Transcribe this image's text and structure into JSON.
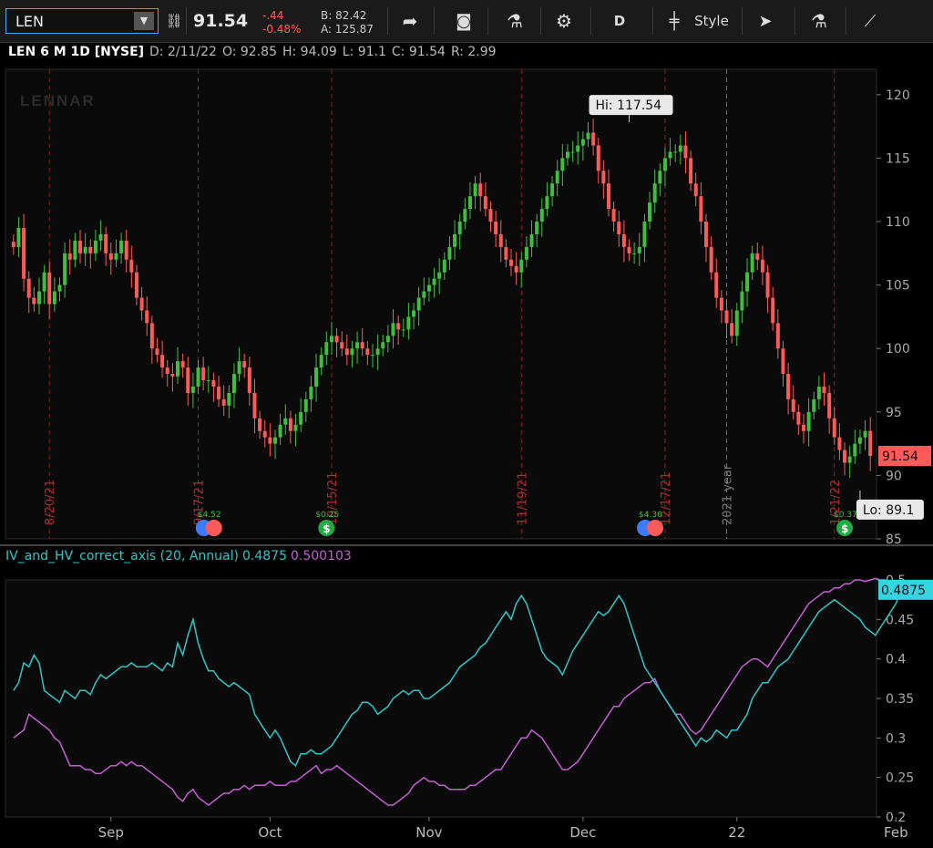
{
  "toolbar": {
    "symbol": "LEN",
    "last": "91.54",
    "change": "-.44",
    "change_pct": "-0.48%",
    "bid": "B: 82.42",
    "ask": "A: 125.87",
    "aggregation": "D",
    "style_label": "Style",
    "icons": [
      "link-icon",
      "share-icon",
      "alert-icon",
      "flask-icon",
      "gear-icon",
      "candle-icon",
      "cursor-icon",
      "studies-icon",
      "drawings-icon"
    ]
  },
  "infobar": {
    "title": "LEN 6 M 1D [NYSE]",
    "date": "D: 2/11/22",
    "open": "O: 92.85",
    "high": "H: 94.09",
    "low": "L: 91.1",
    "close": "C: 91.54",
    "range": "R: 2.99"
  },
  "colors": {
    "up": "#3fbf3f",
    "down": "#ff5a5a",
    "iv": "#2fc7c7",
    "hv": "#c45fd2"
  },
  "chart_data": [
    {
      "type": "candlestick",
      "watermark": "LENNAR",
      "ylim": [
        85,
        122
      ],
      "yticks": [
        85,
        90,
        95,
        100,
        105,
        110,
        115,
        120
      ],
      "xlabels": [
        {
          "label": "Sep",
          "index": 19
        },
        {
          "label": "Oct",
          "index": 50
        },
        {
          "label": "Nov",
          "index": 81
        },
        {
          "label": "Dec",
          "index": 111
        },
        {
          "label": "22",
          "index": 141
        },
        {
          "label": "Feb",
          "index": 172
        }
      ],
      "last_price": "91.54",
      "hi_label": "Hi: 117.54",
      "lo_label": "Lo: 89.1",
      "hi_index": 120,
      "lo_index": 165,
      "hi_value": 117.54,
      "lo_value": 89.1,
      "vlines": [
        {
          "label": "8/20/21",
          "index": 7,
          "color": "#8a2020"
        },
        {
          "label": "9/17/21",
          "index": 36,
          "color": "#8a2020"
        },
        {
          "label": "10/15/21",
          "index": 62,
          "color": "#8a2020"
        },
        {
          "label": "11/19/21",
          "index": 99,
          "color": "#8a2020"
        },
        {
          "label": "12/17/21",
          "index": 127,
          "color": "#8a2020"
        },
        {
          "label": "2021 year",
          "index": 139,
          "color": "#707070"
        },
        {
          "label": "1/21/22",
          "index": 160,
          "color": "#8a2020"
        }
      ],
      "events": [
        {
          "label": "$4.52",
          "index": 38,
          "kind": "earnings"
        },
        {
          "label": "$0.25",
          "index": 61,
          "kind": "dividend"
        },
        {
          "label": "$4.36",
          "index": 124,
          "kind": "earnings"
        },
        {
          "label": "$0.37",
          "index": 162,
          "kind": "dividend"
        }
      ],
      "closes": [
        108,
        109.5,
        105.5,
        104,
        103.5,
        104.5,
        106,
        103.5,
        104.5,
        105,
        107.5,
        107,
        108.5,
        107.5,
        108,
        107.5,
        108.5,
        109,
        107.5,
        107,
        107.5,
        108.5,
        107,
        106,
        104,
        103,
        102,
        100,
        99.5,
        98.5,
        98,
        97.8,
        99,
        98.5,
        96.5,
        97,
        98.5,
        97.5,
        97.5,
        97,
        96,
        95.5,
        96.5,
        98,
        99,
        98.5,
        96.5,
        94.5,
        93.5,
        93,
        92.5,
        93,
        94,
        94.5,
        93.5,
        94,
        95,
        96,
        97,
        98.5,
        99.5,
        100.5,
        101,
        100.5,
        100,
        99.5,
        100,
        100.5,
        100,
        99.5,
        99.5,
        100,
        100.5,
        101,
        102,
        101.5,
        101.5,
        102.5,
        103,
        104,
        104.5,
        105,
        105.5,
        106,
        107,
        108,
        109,
        110,
        111,
        112,
        113,
        112,
        111,
        110,
        109,
        108,
        107,
        106.5,
        106,
        107,
        108,
        109,
        110,
        111,
        112,
        113,
        114,
        115,
        115.5,
        115.5,
        116,
        116.5,
        117,
        116,
        114,
        113,
        111,
        110,
        109,
        108,
        107.5,
        107.5,
        108,
        110,
        111.5,
        113,
        114,
        115,
        115.5,
        115.5,
        116,
        115,
        113,
        112,
        110,
        108,
        106,
        104,
        103,
        102,
        101,
        103,
        104.5,
        106,
        107.5,
        107,
        106,
        104,
        102,
        100,
        98,
        96,
        95,
        94,
        93.5,
        95,
        96,
        97,
        96.5,
        94.5,
        93,
        92,
        91,
        91.5,
        92.5,
        93,
        93.5,
        91.54
      ],
      "series_study": {
        "title": "IV_and_HV_correct_axis (20, Annual)",
        "iv_value": "0.4875",
        "hv_value": "0.500103",
        "ylim": [
          0.2,
          0.5
        ],
        "yticks": [
          0.2,
          0.25,
          0.3,
          0.35,
          0.4,
          0.45,
          0.5
        ],
        "iv": [
          0.36,
          0.37,
          0.395,
          0.39,
          0.405,
          0.395,
          0.36,
          0.355,
          0.35,
          0.345,
          0.36,
          0.355,
          0.35,
          0.36,
          0.36,
          0.355,
          0.37,
          0.38,
          0.375,
          0.38,
          0.385,
          0.39,
          0.39,
          0.395,
          0.39,
          0.39,
          0.39,
          0.395,
          0.39,
          0.385,
          0.395,
          0.39,
          0.42,
          0.405,
          0.43,
          0.45,
          0.42,
          0.4,
          0.385,
          0.385,
          0.375,
          0.37,
          0.365,
          0.37,
          0.365,
          0.36,
          0.355,
          0.33,
          0.32,
          0.31,
          0.3,
          0.31,
          0.3,
          0.285,
          0.27,
          0.265,
          0.28,
          0.28,
          0.285,
          0.28,
          0.28,
          0.285,
          0.29,
          0.3,
          0.31,
          0.32,
          0.33,
          0.335,
          0.345,
          0.345,
          0.34,
          0.33,
          0.335,
          0.34,
          0.35,
          0.355,
          0.36,
          0.355,
          0.36,
          0.36,
          0.35,
          0.35,
          0.355,
          0.36,
          0.365,
          0.37,
          0.38,
          0.39,
          0.395,
          0.4,
          0.405,
          0.415,
          0.42,
          0.43,
          0.44,
          0.45,
          0.46,
          0.45,
          0.47,
          0.48,
          0.47,
          0.45,
          0.43,
          0.41,
          0.4,
          0.395,
          0.39,
          0.38,
          0.395,
          0.41,
          0.42,
          0.43,
          0.44,
          0.45,
          0.46,
          0.455,
          0.46,
          0.47,
          0.48,
          0.47,
          0.45,
          0.43,
          0.41,
          0.39,
          0.38,
          0.37,
          0.36,
          0.35,
          0.34,
          0.33,
          0.32,
          0.31,
          0.3,
          0.29,
          0.3,
          0.295,
          0.3,
          0.31,
          0.305,
          0.3,
          0.31,
          0.31,
          0.32,
          0.33,
          0.35,
          0.36,
          0.37,
          0.37,
          0.38,
          0.39,
          0.395,
          0.4,
          0.41,
          0.42,
          0.43,
          0.44,
          0.45,
          0.46,
          0.465,
          0.47,
          0.475,
          0.47,
          0.465,
          0.46,
          0.455,
          0.45,
          0.44,
          0.435,
          0.43,
          0.44,
          0.45,
          0.46,
          0.47,
          0.4875
        ],
        "hv": [
          0.3,
          0.305,
          0.31,
          0.33,
          0.325,
          0.32,
          0.315,
          0.31,
          0.3,
          0.295,
          0.28,
          0.265,
          0.265,
          0.265,
          0.26,
          0.26,
          0.255,
          0.255,
          0.26,
          0.265,
          0.265,
          0.27,
          0.265,
          0.27,
          0.265,
          0.265,
          0.26,
          0.255,
          0.25,
          0.245,
          0.24,
          0.235,
          0.225,
          0.22,
          0.23,
          0.235,
          0.225,
          0.22,
          0.215,
          0.22,
          0.225,
          0.23,
          0.23,
          0.235,
          0.235,
          0.24,
          0.235,
          0.24,
          0.24,
          0.24,
          0.245,
          0.24,
          0.24,
          0.24,
          0.245,
          0.245,
          0.25,
          0.255,
          0.26,
          0.265,
          0.255,
          0.26,
          0.26,
          0.265,
          0.26,
          0.255,
          0.25,
          0.245,
          0.24,
          0.235,
          0.23,
          0.225,
          0.22,
          0.215,
          0.215,
          0.22,
          0.225,
          0.23,
          0.24,
          0.245,
          0.25,
          0.245,
          0.245,
          0.24,
          0.24,
          0.235,
          0.235,
          0.235,
          0.235,
          0.24,
          0.24,
          0.245,
          0.25,
          0.255,
          0.26,
          0.26,
          0.27,
          0.28,
          0.29,
          0.3,
          0.3,
          0.31,
          0.305,
          0.3,
          0.29,
          0.28,
          0.27,
          0.26,
          0.26,
          0.265,
          0.27,
          0.28,
          0.29,
          0.3,
          0.31,
          0.32,
          0.33,
          0.34,
          0.34,
          0.35,
          0.355,
          0.36,
          0.365,
          0.37,
          0.37,
          0.375,
          0.36,
          0.35,
          0.34,
          0.33,
          0.33,
          0.32,
          0.31,
          0.305,
          0.31,
          0.32,
          0.33,
          0.34,
          0.35,
          0.36,
          0.37,
          0.38,
          0.39,
          0.395,
          0.4,
          0.4,
          0.395,
          0.39,
          0.4,
          0.41,
          0.42,
          0.43,
          0.44,
          0.45,
          0.46,
          0.47,
          0.475,
          0.48,
          0.485,
          0.485,
          0.49,
          0.49,
          0.495,
          0.495,
          0.5,
          0.5,
          0.498,
          0.5,
          0.502,
          0.5,
          0.500103
        ]
      }
    }
  ]
}
